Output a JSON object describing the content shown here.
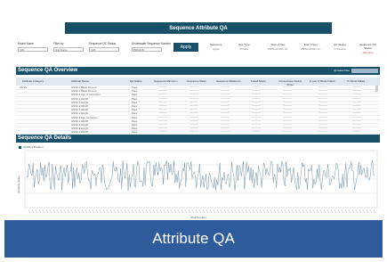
{
  "dashboard": {
    "title": "Sequence Attribute QA",
    "apply_label": "Apply"
  },
  "filters": [
    {
      "label": "Model Name",
      "value": "(All)"
    },
    {
      "label": "Filter by",
      "value": "Hist Apple"
    },
    {
      "label": "Sequence QC Status",
      "value": "(All)"
    },
    {
      "label": "Underwater Sequence Number",
      "value": "PRM11B"
    }
  ],
  "meta": [
    {
      "label": "Sequence",
      "value": "Apple"
    },
    {
      "label": "Seq Type",
      "value": "Private"
    },
    {
      "label": "Start of Seq",
      "value": "2/9/Nov/2021 10:"
    },
    {
      "label": "End of Seq",
      "value": "2/9/Nov/2021 11:"
    },
    {
      "label": "QC Status",
      "value": "In Review"
    },
    {
      "label": "Sequence QA Status",
      "value": "Attention",
      "red": true
    }
  ],
  "overview": {
    "title": "Sequence QA Overview",
    "toggle_label": "QA Status Filter",
    "columns": [
      "Attribute Category",
      "Attribute Name",
      "QA Status",
      "Sequence Minimum",
      "Sequence Mean",
      "Sequence Maximum",
      "Failed Shots",
      "Consecutive Failed Shots",
      "# over # Shots Failed",
      "% Shots Failed"
    ],
    "rows": [
      {
        "category": "GNSS",
        "name": "GNSS 1 Blank Percent",
        "status": "Pass"
      },
      {
        "category": "",
        "name": "GNSS 2 Blank Percent",
        "status": "Pass"
      },
      {
        "category": "",
        "name": "GNSS 1 Age of Correction",
        "status": "Pass"
      },
      {
        "category": "",
        "name": "GNSS 1 HDOP",
        "status": "Pass"
      },
      {
        "category": "",
        "name": "GNSS 1 Height",
        "status": "Pass"
      },
      {
        "category": "",
        "name": "GNSS 2 HDOP",
        "status": "Pass"
      },
      {
        "category": "",
        "name": "GNSS 1 HDOP",
        "status": "Pass"
      },
      {
        "category": "",
        "name": "GNSS 2 Height",
        "status": "Pass"
      },
      {
        "category": "",
        "name": "GNSS 2 Age Correction",
        "status": "Pass"
      },
      {
        "category": "",
        "name": "GNSS 1 HDOP",
        "status": "Pass"
      },
      {
        "category": "",
        "name": "GNSS 1 Height",
        "status": "Pass"
      },
      {
        "category": "",
        "name": "GNSS 2 Height",
        "status": "Pass"
      },
      {
        "category": "",
        "name": "GNSS 2 HDOP",
        "status": "Pass"
      }
    ]
  },
  "details": {
    "title": "Sequence QA Details",
    "legend": "GNSS 1 Position",
    "ylabel": "Attribute Value",
    "xlabel": "Shot Number"
  },
  "footer": {
    "caption": "Attribute QA"
  },
  "colors": {
    "header": "#18506a",
    "footer": "#2f5a9c",
    "series": "#6f8fa6"
  }
}
